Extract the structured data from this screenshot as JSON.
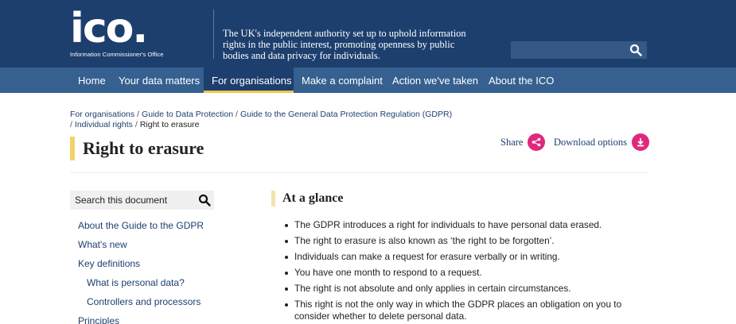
{
  "header": {
    "logo_text": "ico.",
    "logo_subtitle": "Information Commissioner's Office",
    "tagline": "The UK's independent authority set up to uphold information rights in the public interest, promoting openness by public bodies and data privacy for individuals.",
    "search_icon": "search-icon",
    "colors": {
      "header_bg": "#1d3f6e",
      "nav_bg": "#35608f",
      "accent": "#e0287d",
      "highlight": "#f2c64b"
    }
  },
  "nav": {
    "items": [
      {
        "label": "Home"
      },
      {
        "label": "Your data matters"
      },
      {
        "label": "For organisations",
        "active": true
      },
      {
        "label": "Make a complaint"
      },
      {
        "label": "Action we've taken"
      },
      {
        "label": "About the ICO"
      }
    ]
  },
  "breadcrumb": {
    "items": [
      "For organisations",
      "Guide to Data Protection",
      "Guide to the General Data Protection Regulation (GDPR)",
      "Individual rights"
    ],
    "current": "Right to erasure",
    "separator": "/"
  },
  "page": {
    "title": "Right to erasure",
    "share_label": "Share",
    "share_icon": "share-icon",
    "download_label": "Download options",
    "download_icon": "download-icon"
  },
  "sidebar": {
    "search_label": "Search this document",
    "search_icon": "search-icon",
    "links": [
      {
        "label": "About the Guide to the GDPR",
        "indent": false
      },
      {
        "label": "What's new",
        "indent": false
      },
      {
        "label": "Key definitions",
        "indent": false
      },
      {
        "label": "What is personal data?",
        "indent": true
      },
      {
        "label": "Controllers and processors",
        "indent": true
      },
      {
        "label": "Principles",
        "indent": false
      }
    ]
  },
  "main": {
    "section_title": "At a glance",
    "bullets": [
      "The GDPR introduces a right for individuals to have personal data erased.",
      "The right to erasure is also known as ‘the right to be forgotten’.",
      "Individuals can make a request for erasure verbally or in writing.",
      "You have one month to respond to a request.",
      "The right is not absolute and only applies in certain circumstances.",
      "This right is not the only way in which the GDPR places an obligation on you to consider whether to delete personal data."
    ]
  }
}
